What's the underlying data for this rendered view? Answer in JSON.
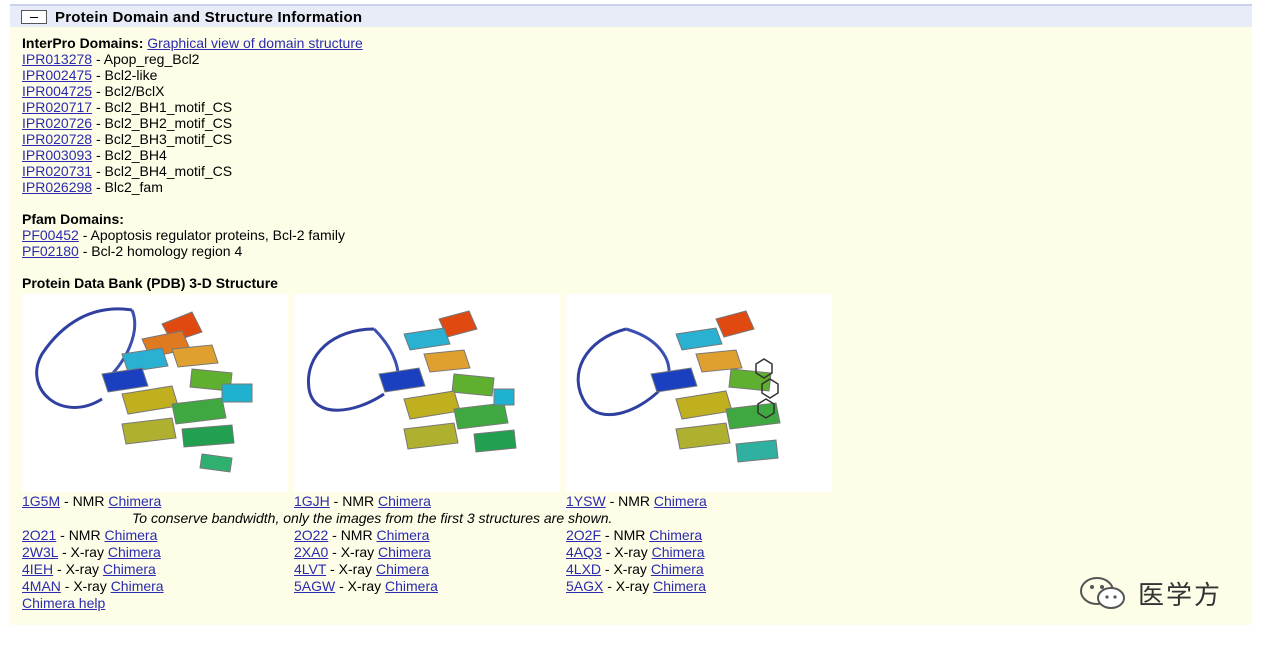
{
  "header": {
    "title": "Protein Domain and Structure Information"
  },
  "interpro": {
    "label": "InterPro Domains:",
    "graph_link": "Graphical view of domain structure",
    "items": [
      {
        "id": "IPR013278",
        "desc": "Apop_reg_Bcl2"
      },
      {
        "id": "IPR002475",
        "desc": "Bcl2-like"
      },
      {
        "id": "IPR004725",
        "desc": "Bcl2/BclX"
      },
      {
        "id": "IPR020717",
        "desc": "Bcl2_BH1_motif_CS"
      },
      {
        "id": "IPR020726",
        "desc": "Bcl2_BH2_motif_CS"
      },
      {
        "id": "IPR020728",
        "desc": "Bcl2_BH3_motif_CS"
      },
      {
        "id": "IPR003093",
        "desc": "Bcl2_BH4"
      },
      {
        "id": "IPR020731",
        "desc": "Bcl2_BH4_motif_CS"
      },
      {
        "id": "IPR026298",
        "desc": "Blc2_fam"
      }
    ]
  },
  "pfam": {
    "label": "Pfam Domains:",
    "items": [
      {
        "id": "PF00452",
        "desc": "Apoptosis regulator proteins, Bcl-2 family"
      },
      {
        "id": "PF02180",
        "desc": "Bcl-2 homology region 4"
      }
    ]
  },
  "pdb": {
    "label": "Protein Data Bank (PDB) 3-D Structure",
    "separator": " - ",
    "chimera": "Chimera",
    "note": "To conserve bandwidth, only the images from the first 3 structures are shown.",
    "help": "Chimera help",
    "columns": [
      [
        {
          "id": "1G5M",
          "method": "NMR"
        },
        {
          "id": "2O21",
          "method": "NMR"
        },
        {
          "id": "2W3L",
          "method": "X-ray"
        },
        {
          "id": "4IEH",
          "method": "X-ray"
        },
        {
          "id": "4MAN",
          "method": "X-ray"
        }
      ],
      [
        {
          "id": "1GJH",
          "method": "NMR"
        },
        {
          "id": "2O22",
          "method": "NMR"
        },
        {
          "id": "2XA0",
          "method": "X-ray"
        },
        {
          "id": "4LVT",
          "method": "X-ray"
        },
        {
          "id": "5AGW",
          "method": "X-ray"
        }
      ],
      [
        {
          "id": "1YSW",
          "method": "NMR"
        },
        {
          "id": "2O2F",
          "method": "NMR"
        },
        {
          "id": "4AQ3",
          "method": "X-ray"
        },
        {
          "id": "4LXD",
          "method": "X-ray"
        },
        {
          "id": "5AGX",
          "method": "X-ray"
        }
      ]
    ]
  },
  "watermark": {
    "text": "医学方",
    "icon": "wechat-icon"
  },
  "colors": {
    "link": "#2b2bb0",
    "panel_bg": "#fefee8",
    "header_bg": "#e8ecf8"
  }
}
